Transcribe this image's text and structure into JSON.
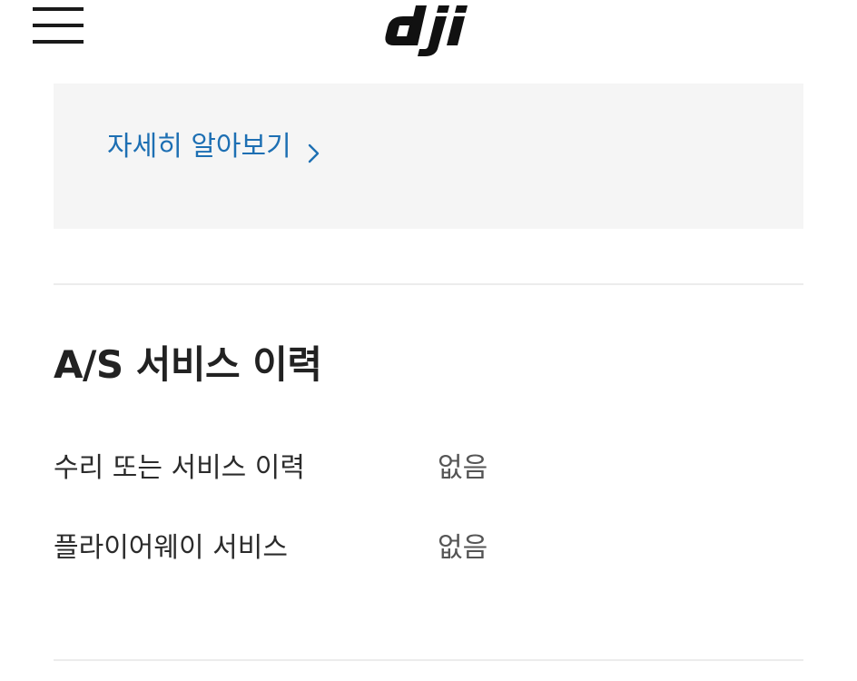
{
  "header": {
    "menu_icon": "hamburger-menu-icon",
    "logo_text": "dji"
  },
  "promo": {
    "learn_more_label": "자세히 알아보기",
    "chevron_icon": "chevron-right-icon",
    "link_color": "#1d6fb3",
    "background": "#f5f5f5"
  },
  "as_history": {
    "title": "A/S 서비스 이력",
    "rows": [
      {
        "label": "수리 또는 서비스 이력",
        "value": "없음"
      },
      {
        "label": "플라이어웨이 서비스",
        "value": "없음"
      }
    ]
  }
}
